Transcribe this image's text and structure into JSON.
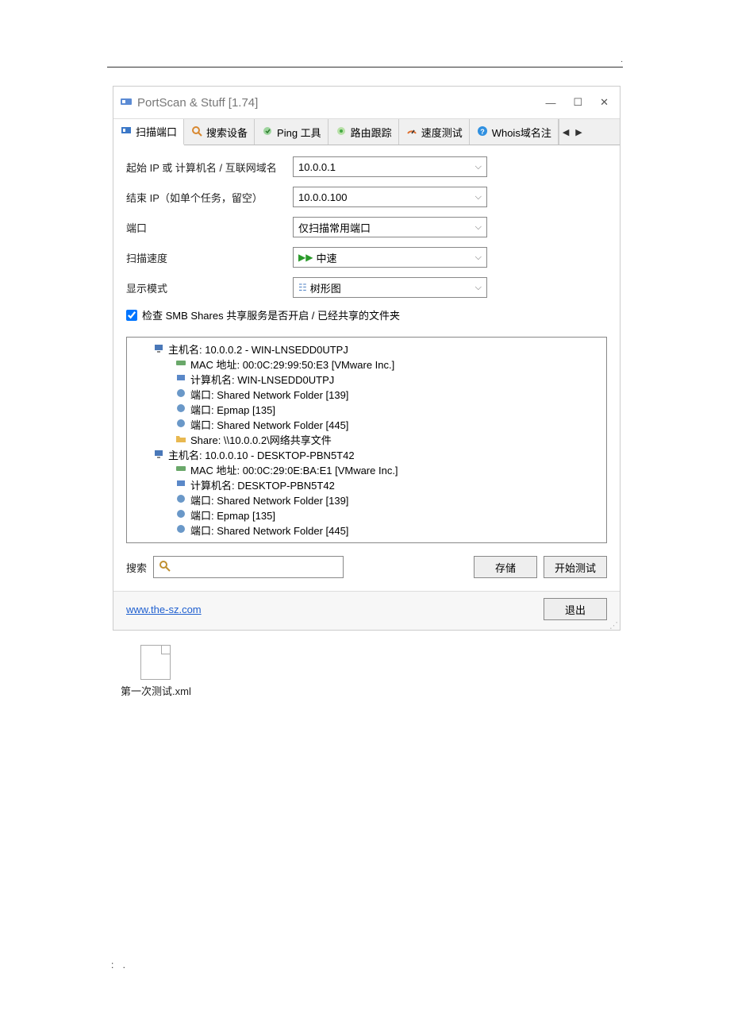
{
  "window": {
    "title": "PortScan & Stuff [1.74]",
    "minimize": "—",
    "maximize": "☐",
    "close": "✕"
  },
  "tabs": {
    "scan_ports": "扫描端口",
    "search_devices": "搜索设备",
    "ping_tool": "Ping 工具",
    "route_trace": "路由跟踪",
    "speed_test": "速度测试",
    "whois": "Whois域名注"
  },
  "form": {
    "start_ip_label": "起始 IP 或 计算机名 / 互联网域名",
    "end_ip_label": "结束 IP（如单个任务，留空）",
    "ports_label": "端口",
    "scan_speed_label": "扫描速度",
    "display_mode_label": "显示模式",
    "start_ip_value": "10.0.0.1",
    "end_ip_value": "10.0.0.100",
    "ports_value": "仅扫描常用端口",
    "scan_speed_value": "中速",
    "display_mode_value": "树形图",
    "checkbox_label": "检查 SMB Shares 共享服务是否开启 / 已经共享的文件夹"
  },
  "tree": {
    "host1_name": "主机名: 10.0.0.2 - WIN-LNSEDD0UTPJ",
    "host1_mac": "MAC 地址: 00:0C:29:99:50:E3 [VMware Inc.]",
    "host1_pc": "计算机名: WIN-LNSEDD0UTPJ",
    "host1_p139": "端口: Shared Network Folder [139]",
    "host1_p135": "端口: Epmap [135]",
    "host1_p445": "端口: Shared Network Folder [445]",
    "host1_share": "Share: \\\\10.0.0.2\\网络共享文件",
    "host2_name": "主机名: 10.0.0.10 - DESKTOP-PBN5T42",
    "host2_mac": "MAC 地址: 00:0C:29:0E:BA:E1 [VMware Inc.]",
    "host2_pc": "计算机名: DESKTOP-PBN5T42",
    "host2_p139": "端口: Shared Network Folder [139]",
    "host2_p135": "端口: Epmap [135]",
    "host2_p445": "端口: Shared Network Folder [445]"
  },
  "bottom": {
    "search_label": "搜索",
    "save_btn": "存储",
    "start_btn": "开始测试"
  },
  "footer": {
    "link": "www.the-sz.com",
    "exit_btn": "退出"
  },
  "desktop": {
    "file_name": "第一次测试.xml"
  },
  "page_num": ": ."
}
